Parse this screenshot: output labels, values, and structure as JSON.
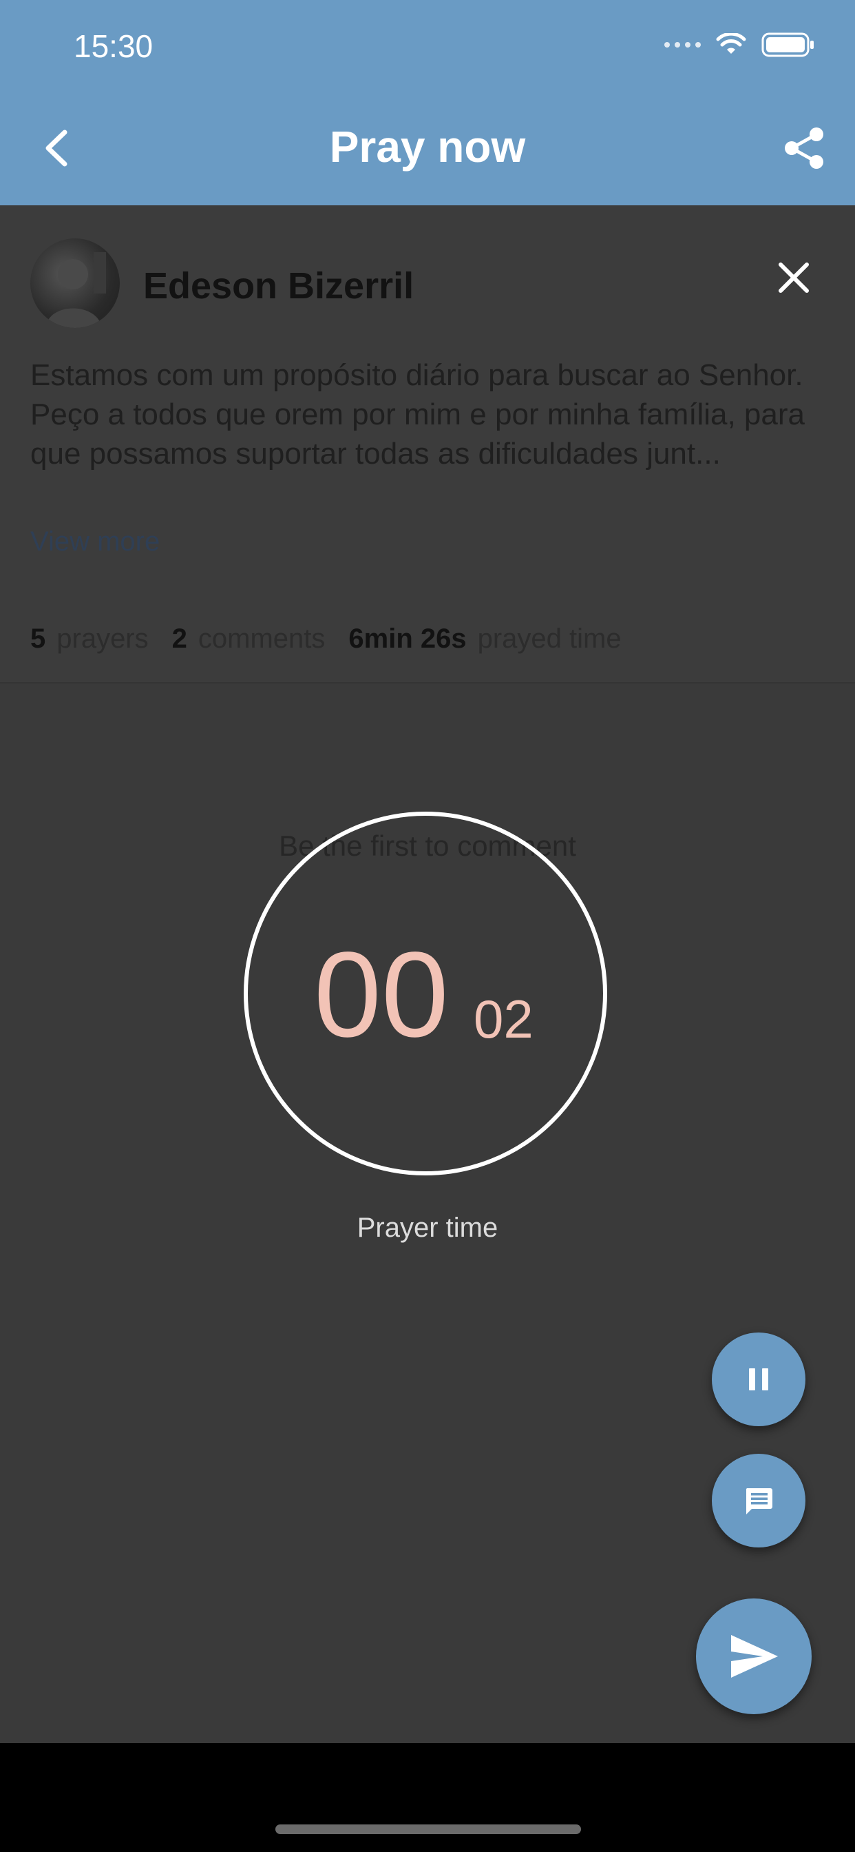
{
  "status_bar": {
    "time": "15:30"
  },
  "header": {
    "title": "Pray now"
  },
  "post": {
    "author": "Edeson Bizerril",
    "text": "Estamos com um propósito diário para buscar ao Senhor. Peço a todos que orem por mim e por minha família, para que possamos suportar todas as dificuldades junt...",
    "view_more": "View more"
  },
  "stats": {
    "prayers_count": "5",
    "prayers_label": "prayers",
    "comments_count": "2",
    "comments_label": "comments",
    "prayed_time_value": "6min 26s",
    "prayed_time_label": "prayed time"
  },
  "comments": {
    "empty_text": "Be the first to comment"
  },
  "timer": {
    "minutes": "00",
    "seconds": "02",
    "label": "Prayer time"
  },
  "colors": {
    "header": "#6a9bc4",
    "overlay_background": "#3a3a3a",
    "timer_digits": "#f2c3b6",
    "fab": "#6a9bc4"
  },
  "icons": {
    "back": "chevron-left-icon",
    "share": "share-icon",
    "close": "close-icon",
    "pause": "pause-icon",
    "comment": "comment-icon",
    "send": "send-icon"
  }
}
